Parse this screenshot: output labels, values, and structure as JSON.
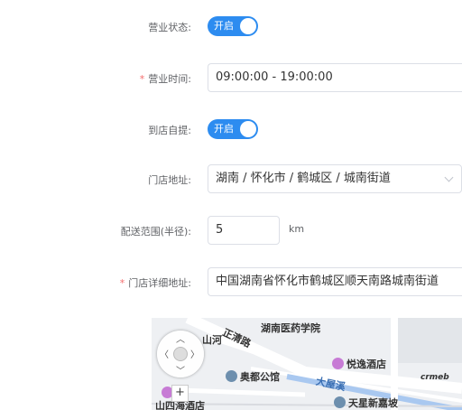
{
  "form": {
    "business_status": {
      "label": "营业状态:",
      "switch_text": "开启"
    },
    "business_hours": {
      "required": "*",
      "label": "营业时间:",
      "value": "09:00:00 - 19:00:00"
    },
    "pickup": {
      "label": "到店自提:",
      "switch_text": "开启"
    },
    "store_address": {
      "label": "门店地址:",
      "value": "湖南 / 怀化市 / 鹤城区 / 城南街道"
    },
    "delivery_range": {
      "label": "配送范围(半径):",
      "value": "5",
      "unit": "km"
    },
    "detail_address": {
      "required": "*",
      "label": "门店详细地址:",
      "value": "中国湖南省怀化市鹤城区顺天南路城南街道"
    }
  },
  "map": {
    "labels": {
      "hospital": "湖南医药学院",
      "road": "正清路",
      "hill": "山河",
      "hotel": "悦逸酒店",
      "sports": "奥都公馆",
      "stream": "大屋溪",
      "new_building": "天星新嘉坡",
      "shop": "山四海酒店"
    },
    "zoom_in": "+",
    "logo": "crmeb"
  },
  "colors": {
    "accent": "#2d8cf0",
    "required": "#f56c6c"
  }
}
